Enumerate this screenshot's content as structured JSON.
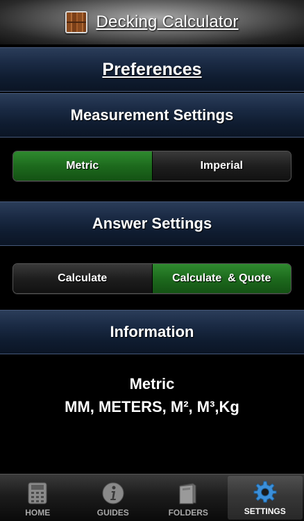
{
  "titlebar": {
    "title": "Decking Calculator",
    "icon": "deck-planks-icon"
  },
  "sections": {
    "preferences": "Preferences",
    "measurement": "Measurement Settings",
    "answer": "Answer Settings",
    "information": "Information"
  },
  "measurement_toggle": {
    "options": [
      "Metric",
      "Imperial"
    ],
    "selected": "Metric"
  },
  "answer_toggle": {
    "options": [
      "Calculate",
      "Calculate  & Quote"
    ],
    "selected": "Calculate  & Quote"
  },
  "info": {
    "line1": "Metric",
    "line2": "MM, METERS, M², M³,Kg"
  },
  "tabs": [
    {
      "label": "HOME",
      "icon": "calculator-icon"
    },
    {
      "label": "GUIDES",
      "icon": "info-icon"
    },
    {
      "label": "FOLDERS",
      "icon": "folder-icon"
    },
    {
      "label": "SETTINGS",
      "icon": "gear-icon"
    }
  ],
  "active_tab": "SETTINGS",
  "colors": {
    "accent_green": "#1d6a1d",
    "header_navy": "#1a2a44",
    "gear_blue": "#3b8fd9"
  }
}
